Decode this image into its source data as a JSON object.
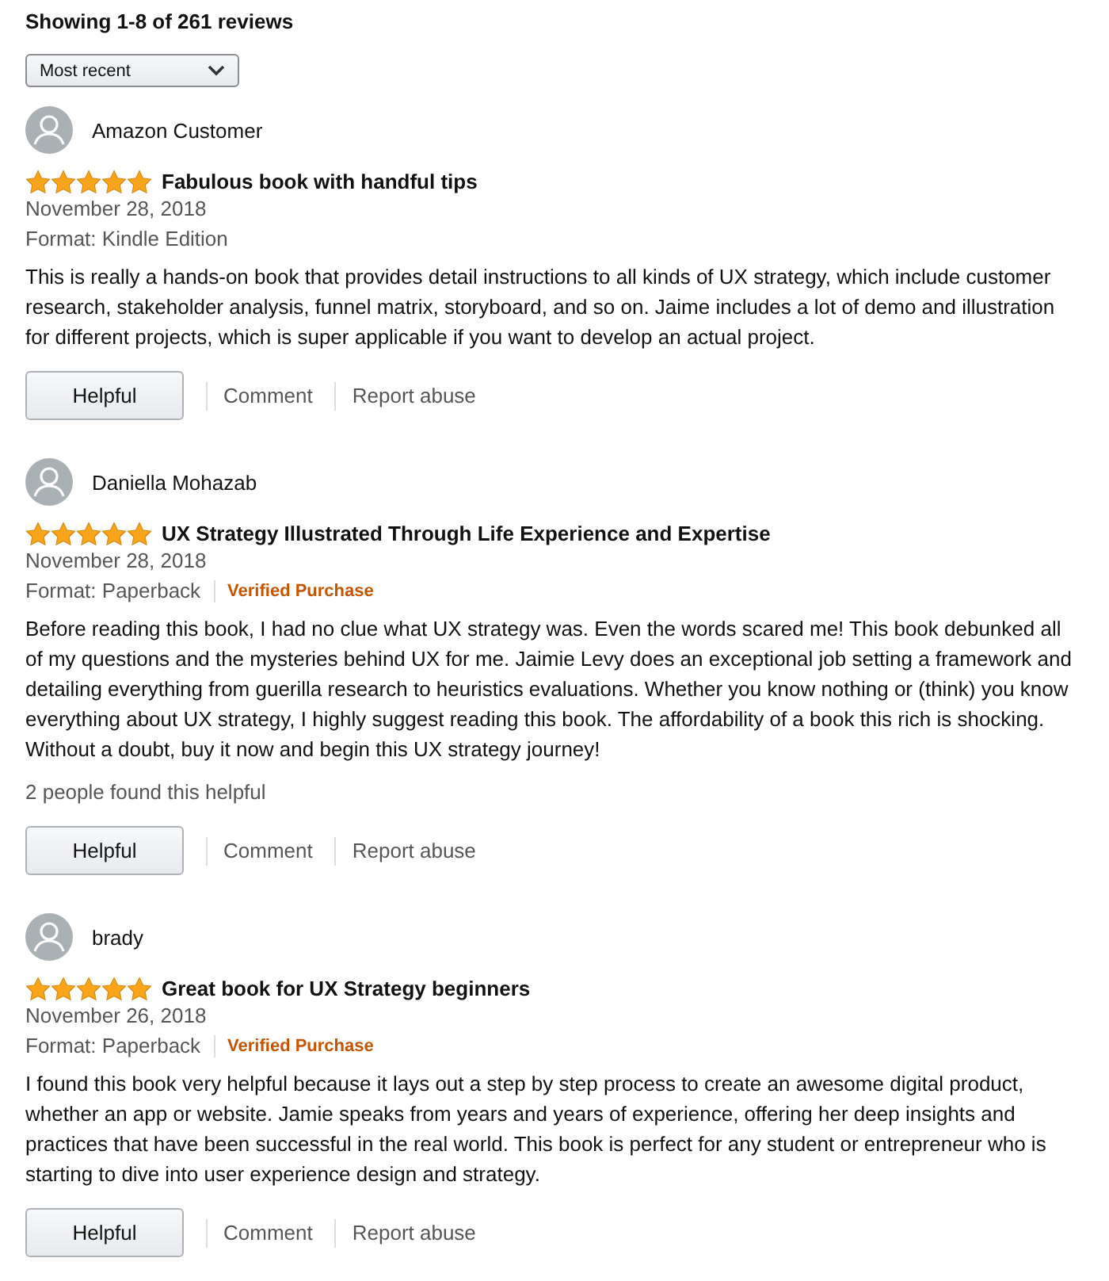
{
  "heading": "Showing 1-8 of 261 reviews",
  "sort": {
    "value": "Most recent"
  },
  "reviews": [
    {
      "author": "Amazon Customer",
      "stars": 5,
      "title": "Fabulous book with handful tips",
      "date": "November 28, 2018",
      "format": "Format: Kindle Edition",
      "body": "This is really a hands-on book that provides detail instructions to all kinds of UX strategy, which include customer research, stakeholder analysis, funnel matrix, storyboard, and so on. Jaime includes a lot of demo and illustration for different projects, which is super applicable if you want to develop an actual project.",
      "actions": [
        "Helpful",
        "Comment",
        "Report abuse"
      ]
    },
    {
      "author": "Daniella Mohazab",
      "stars": 5,
      "title": "UX Strategy Illustrated Through Life Experience and Expertise",
      "date": "November 28, 2018",
      "format": "Format: Paperback",
      "badge": "Verified Purchase",
      "body": "Before reading this book, I had no clue what UX strategy was. Even the words scared me! This book debunked all of my questions and the mysteries behind UX for me. Jaimie Levy does an exceptional job setting a framework and detailing everything from guerilla research to heuristics evaluations. Whether you know nothing or (think) you know everything about UX strategy, I highly suggest reading this book. The affordability of a book this rich is shocking. Without a doubt, buy it now and begin this UX strategy journey!",
      "helpful_count": "2 people found this helpful",
      "actions": [
        "Helpful",
        "Comment",
        "Report abuse"
      ]
    },
    {
      "author": "brady",
      "stars": 5,
      "title": "Great book for UX Strategy beginners",
      "date": "November 26, 2018",
      "format": "Format: Paperback",
      "badge": "Verified Purchase",
      "body": "I found this book very helpful because it lays out a step by step process to create an awesome digital product, whether an app or website. Jamie speaks from years and years of experience, offering her deep insights and practices that have been successful in the real world. This book is perfect for any student or entrepreneur who is starting to dive into user experience design and strategy.",
      "actions": [
        "Helpful",
        "Comment",
        "Report abuse"
      ]
    }
  ]
}
